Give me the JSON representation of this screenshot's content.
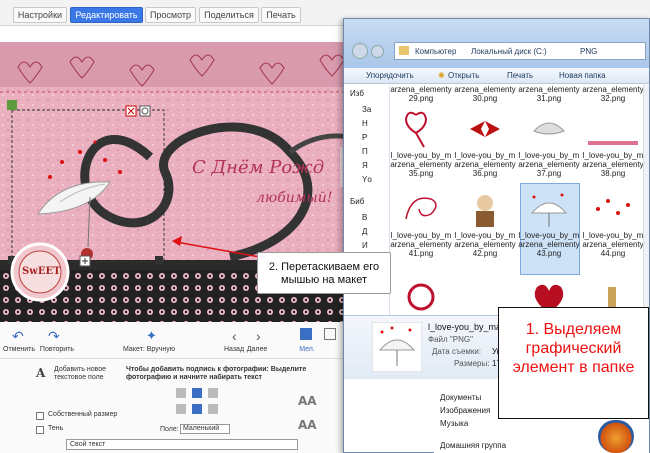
{
  "editor": {
    "tabs": [
      {
        "label": "Настройки"
      },
      {
        "label": "Редактировать"
      },
      {
        "label": "Просмотр"
      },
      {
        "label": "Поделиться"
      },
      {
        "label": "Печать"
      }
    ],
    "canvas": {
      "greeting_line1": "С Днём Рожд",
      "greeting_line2": "любимый!",
      "sweet_badge": "SwEET"
    },
    "toolbar": {
      "undo": "Отменить",
      "redo": "Повторить",
      "layout": "Макет: Вручную",
      "back": "Назад",
      "next": "Далее",
      "tab_mark": "Мел."
    },
    "text_panel": {
      "add_text": "Добавить новое текстовое поле",
      "hint": "Чтобы добавить подпись к фотографии: Выделите фотографию и начните набирать текст",
      "own_size": "Собственный размер",
      "shadow": "Тень",
      "field_label": "Поле:",
      "field_value": "Маленький",
      "text_select": "Свой текст"
    }
  },
  "explorer": {
    "breadcrumb": [
      "Компьютер",
      "Локальный диск (C:)",
      "PNG"
    ],
    "toolbar": {
      "organize": "Упорядочить",
      "open": "Открыть",
      "print": "Печать",
      "new_folder": "Новая папка"
    },
    "nav_items": [
      "Изб",
      "За",
      "Н",
      "Р",
      "П",
      "Я",
      "Yо",
      "Биб",
      "В",
      "Д",
      "И",
      "М"
    ],
    "files": [
      {
        "name": "arzena_elementy\n29.png"
      },
      {
        "name": "arzena_elementy\n30.png"
      },
      {
        "name": "arzena_elementy\n31.png"
      },
      {
        "name": "arzena_elementy\n32.png"
      },
      {
        "name": "l_love-you_by_m\narzena_elementy\n35.png"
      },
      {
        "name": "l_love-you_by_m\narzena_elementy\n36.png"
      },
      {
        "name": "l_love-you_by_m\narzena_elementy\n37.png"
      },
      {
        "name": "l_love-you_by_m\narzena_elementy\n38.png"
      },
      {
        "name": "l_love-you_by_m\narzena_elementy\n41.png"
      },
      {
        "name": "l_love-you_by_m\narzena_elementy\n42.png"
      },
      {
        "name": "l_love-you_by_m\narzena_elementy\n43.png"
      },
      {
        "name": "l_love-you_by_m\narzena_elementy\n44.png"
      }
    ],
    "details": {
      "name": "l_love-you_by_marze",
      "type": "Файл \"PNG\"",
      "date_label": "Дата съемки:",
      "date_value": "Ук",
      "size_label": "Размеры:",
      "size_value": "177"
    },
    "lower_nav": [
      "Документы",
      "Изображения",
      "Музыка",
      "Домашняя группа"
    ]
  },
  "callouts": {
    "step2": "2. Перетаскиваем его мышью на макет",
    "step1": "1. Выделяем графический элемент в папке"
  }
}
